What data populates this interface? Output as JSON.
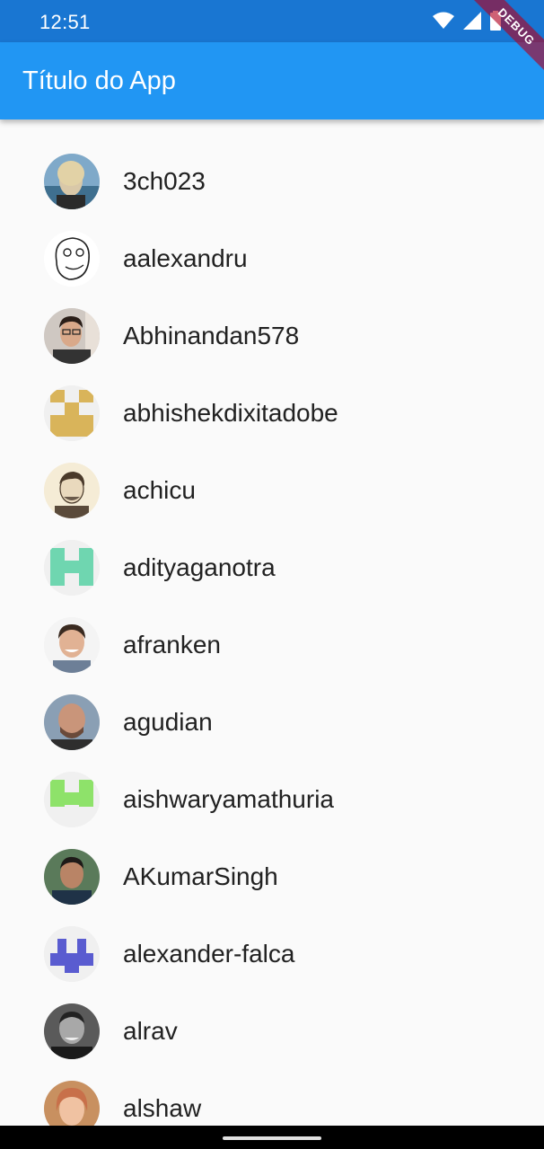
{
  "status_bar": {
    "time": "12:51",
    "icons": [
      "wifi-icon",
      "signal-icon",
      "battery-icon"
    ],
    "debug_label": "DEBUG"
  },
  "app_bar": {
    "title": "Título do App",
    "color": "#2196f3"
  },
  "list": {
    "items": [
      {
        "label": "3ch023",
        "avatar": "photo-avatar"
      },
      {
        "label": "aalexandru",
        "avatar": "meme-face-avatar"
      },
      {
        "label": "Abhinandan578",
        "avatar": "photo-avatar"
      },
      {
        "label": "abhishekdixitadobe",
        "avatar": "identicon-avatar",
        "color": "#d9b45a"
      },
      {
        "label": "achicu",
        "avatar": "sketch-portrait-avatar"
      },
      {
        "label": "adityaganotra",
        "avatar": "identicon-avatar",
        "color": "#6fd6b0"
      },
      {
        "label": "afranken",
        "avatar": "photo-avatar"
      },
      {
        "label": "agudian",
        "avatar": "photo-avatar"
      },
      {
        "label": "aishwaryamathuria",
        "avatar": "identicon-avatar",
        "color": "#8ee26a"
      },
      {
        "label": "AKumarSingh",
        "avatar": "photo-avatar"
      },
      {
        "label": "alexander-falca",
        "avatar": "identicon-avatar",
        "color": "#5a5cd0"
      },
      {
        "label": "alrav",
        "avatar": "photo-avatar"
      },
      {
        "label": "alshaw",
        "avatar": "photo-avatar"
      }
    ]
  }
}
